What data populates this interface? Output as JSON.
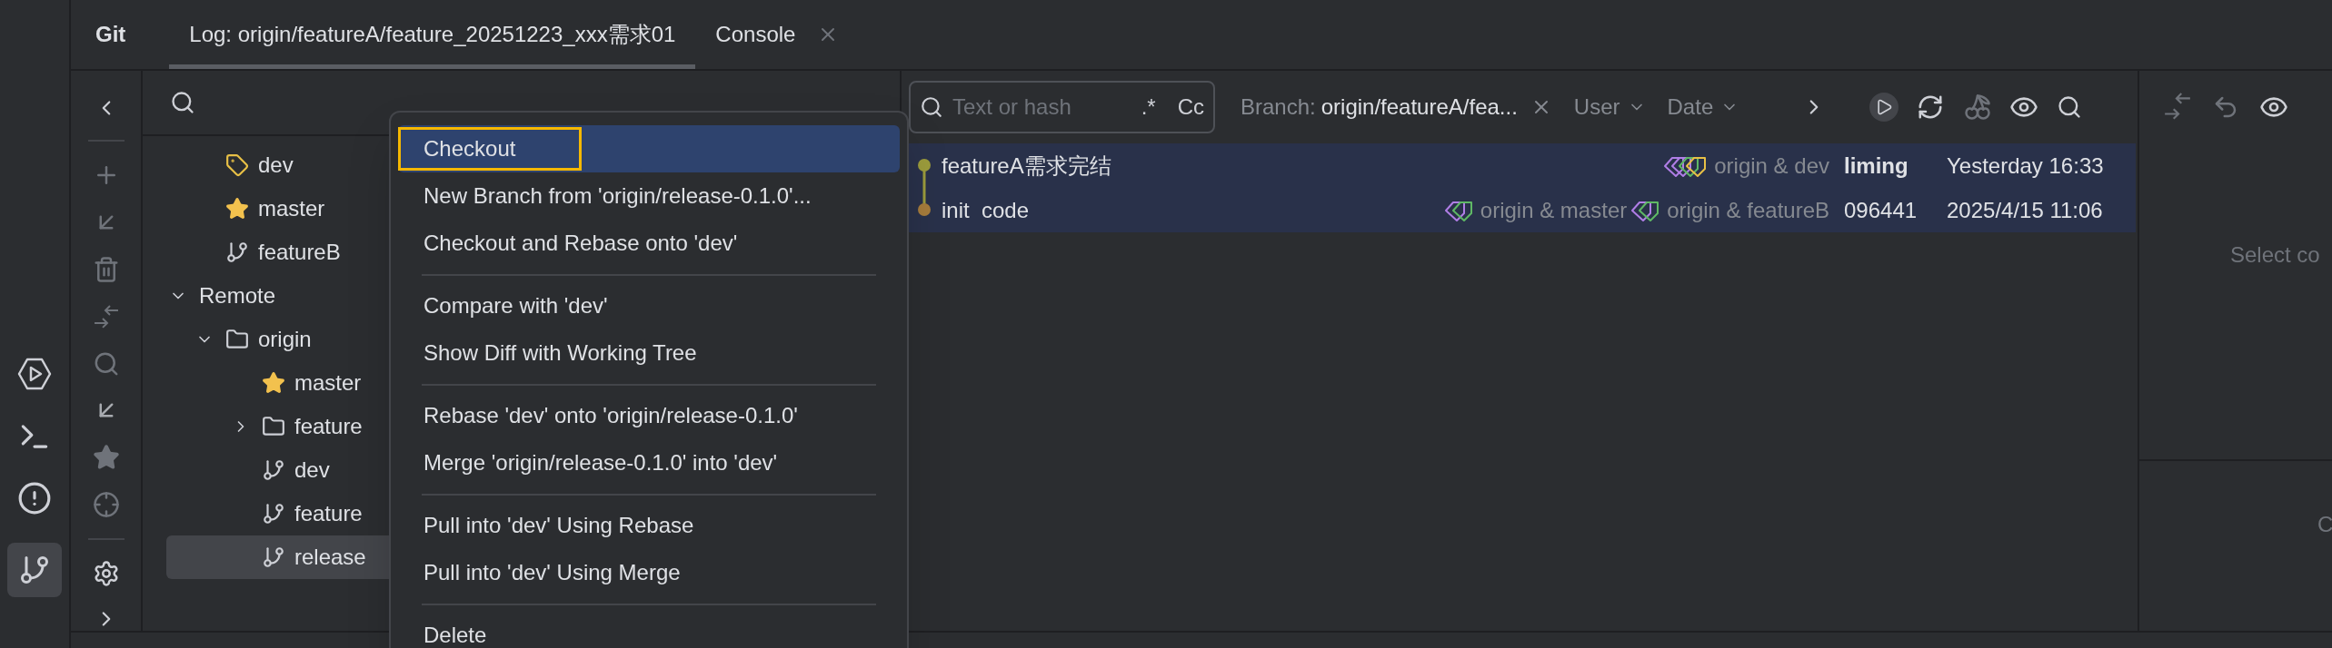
{
  "header": {
    "title": "Git",
    "tabs": [
      {
        "label": "Log: origin/featureA/feature_20251223_xxx需求01",
        "selected": true,
        "closable": false
      },
      {
        "label": "Console",
        "selected": false,
        "closable": true
      }
    ]
  },
  "branches": {
    "local": [
      {
        "label": "dev",
        "kind": "tag",
        "selected": false
      },
      {
        "label": "master",
        "kind": "star",
        "selected": false
      },
      {
        "label": "featureB",
        "kind": "branch",
        "selected": false
      }
    ],
    "remote": {
      "label": "Remote",
      "expanded": true,
      "selected": false,
      "children": [
        {
          "label": "origin",
          "kind": "folder",
          "expanded": true,
          "selected": false,
          "children": [
            {
              "label": "master",
              "kind": "star",
              "selected": false
            },
            {
              "label": "feature",
              "kind": "folder",
              "expanded": false,
              "selected": false
            },
            {
              "label": "dev",
              "kind": "branch",
              "selected": false
            },
            {
              "label": "feature",
              "kind": "branch",
              "selected": false
            },
            {
              "label": "release",
              "kind": "branch",
              "selected": true
            }
          ]
        }
      ]
    }
  },
  "context_menu": {
    "items": [
      {
        "kind": "item",
        "label": "Checkout",
        "selected": true,
        "outlined": true
      },
      {
        "kind": "item",
        "label": "New Branch from 'origin/release-0.1.0'...",
        "selected": false,
        "outlined": false
      },
      {
        "kind": "item",
        "label": "Checkout and Rebase onto 'dev'",
        "selected": false,
        "outlined": false
      },
      {
        "kind": "separator"
      },
      {
        "kind": "item",
        "label": "Compare with 'dev'",
        "selected": false,
        "outlined": false
      },
      {
        "kind": "item",
        "label": "Show Diff with Working Tree",
        "selected": false,
        "outlined": false
      },
      {
        "kind": "separator"
      },
      {
        "kind": "item",
        "label": "Rebase 'dev' onto 'origin/release-0.1.0'",
        "selected": false,
        "outlined": false
      },
      {
        "kind": "item",
        "label": "Merge 'origin/release-0.1.0' into 'dev'",
        "selected": false,
        "outlined": false
      },
      {
        "kind": "separator"
      },
      {
        "kind": "item",
        "label": "Pull into 'dev' Using Rebase",
        "selected": false,
        "outlined": false
      },
      {
        "kind": "item",
        "label": "Pull into 'dev' Using Merge",
        "selected": false,
        "outlined": false
      },
      {
        "kind": "separator"
      },
      {
        "kind": "item",
        "label": "Delete",
        "selected": false,
        "outlined": false
      }
    ]
  },
  "log": {
    "search": {
      "placeholder": "Text or hash",
      "regex": ".*",
      "match_case": "Cc"
    },
    "branch_filter": {
      "label": "Branch:",
      "value": "origin/featureA/fea..."
    },
    "filters": [
      "User",
      "Date"
    ],
    "commits": [
      {
        "subject": "featureA需求完结",
        "color": "#9c9c3c",
        "refs": [
          {
            "label": "origin & dev",
            "tags": [
              {
                "color": "#b07ee6"
              },
              {
                "color": "#b07ee6"
              },
              {
                "color": "#5fb865"
              },
              {
                "color": "#e8c046"
              }
            ]
          }
        ],
        "author": "liming",
        "current_user": true,
        "date": "Yesterday 16:33",
        "selected": true
      },
      {
        "subject": "init  code",
        "color": "#a67c3c",
        "refs": [
          {
            "label": "origin & master",
            "tags": [
              {
                "color": "#b07ee6"
              },
              {
                "color": "#5fb865"
              }
            ]
          },
          {
            "label": "origin & featureB",
            "tags": [
              {
                "color": "#b07ee6"
              },
              {
                "color": "#5fb865"
              }
            ]
          }
        ],
        "author": "096441",
        "current_user": false,
        "date": "2025/4/15 11:06",
        "selected": true
      }
    ]
  },
  "details": {
    "empty_text": "Select co",
    "lower_text": "C"
  }
}
